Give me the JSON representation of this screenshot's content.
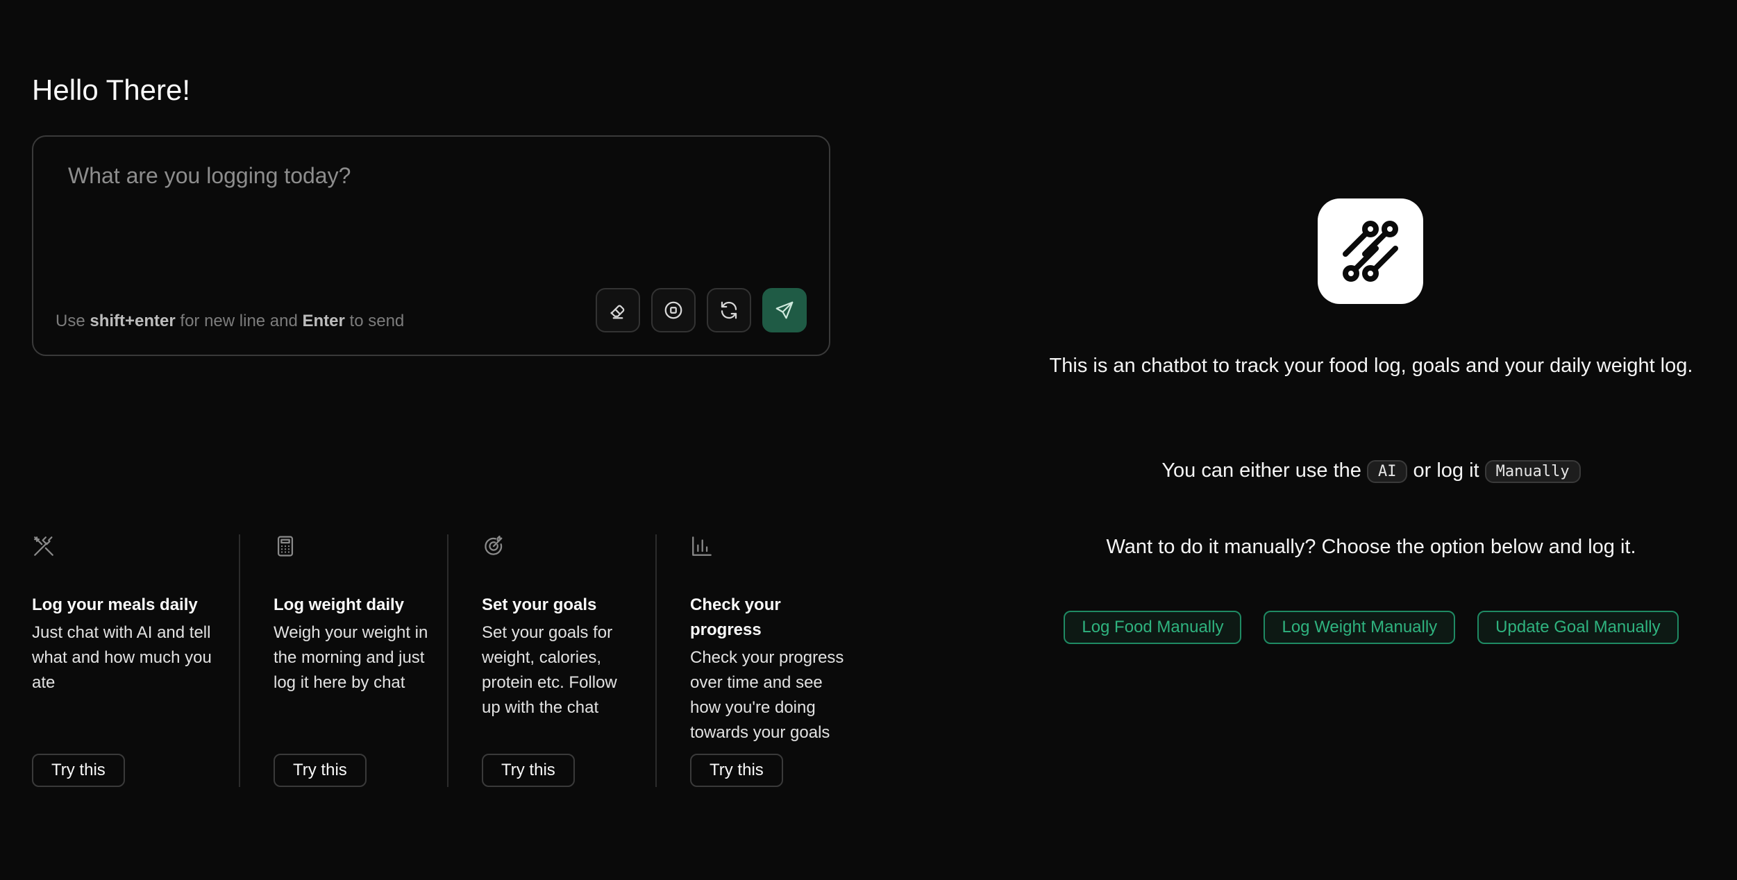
{
  "greeting": "Hello There!",
  "composer": {
    "placeholder": "What are you logging today?",
    "hint_use": "Use ",
    "hint_key1": "shift+enter",
    "hint_mid": " for new line and ",
    "hint_key2": "Enter",
    "hint_end": " to send",
    "tools": [
      "eraser-icon",
      "stop-icon",
      "refresh-icon",
      "send-icon"
    ]
  },
  "cards": [
    {
      "icon": "utensils-icon",
      "title": "Log your meals daily",
      "desc": "Just chat with AI and tell what and how much you ate",
      "button": "Try this"
    },
    {
      "icon": "calculator-icon",
      "title": "Log weight daily",
      "desc": "Weigh your weight in the morning and just log it here by chat",
      "button": "Try this"
    },
    {
      "icon": "target-icon",
      "title": "Set your goals",
      "desc": "Set your goals for weight, calories, protein etc. Follow up with the chat",
      "button": "Try this"
    },
    {
      "icon": "bar-chart-icon",
      "title": "Check your progress",
      "desc": "Check your progress over time and see how you're doing towards your goals",
      "button": "Try this"
    }
  ],
  "right": {
    "intro": "This is an chatbot to track your food log, goals and your daily weight log.",
    "either_prefix": "You can either use the ",
    "chip_ai": "AI",
    "either_mid": " or log it ",
    "chip_manual": "Manually",
    "manual_question": "Want to do it manually? Choose the option below and log it.",
    "buttons": [
      "Log Food Manually",
      "Log Weight Manually",
      "Update Goal Manually"
    ]
  },
  "colors": {
    "background": "#0a0a0a",
    "accent": "#2fb37f",
    "send_button": "#1f5b45"
  }
}
